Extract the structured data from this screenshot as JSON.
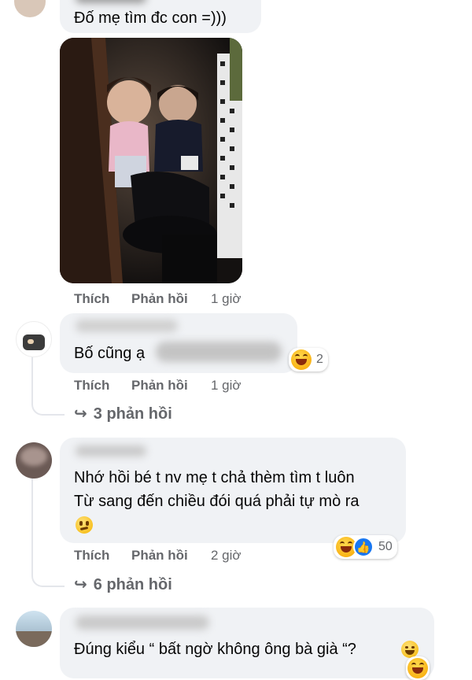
{
  "comment1": {
    "text": "Đố mẹ tìm đc con =)))",
    "actions": {
      "like": "Thích",
      "reply": "Phản hồi",
      "time": "1 giờ"
    }
  },
  "comment2": {
    "text": "Bố cũng ạ",
    "reaction_count": "2",
    "actions": {
      "like": "Thích",
      "reply": "Phản hồi",
      "time": "1 giờ"
    },
    "replies": "3 phản hồi"
  },
  "comment3": {
    "line1": "Nhớ hồi bé t nv mẹ t chả thèm tìm t luôn",
    "line2": "Từ sang đến chiều đói quá phải tự mò ra",
    "reaction_count": "50",
    "actions": {
      "like": "Thích",
      "reply": "Phản hồi",
      "time": "2 giờ"
    },
    "replies": "6 phản hồi"
  },
  "comment4": {
    "text": "Đúng kiểu “ bất ngờ không ông bà già “?"
  },
  "colors": {
    "bubble": "#f0f2f5",
    "meta": "#65676b",
    "like_blue": "#1877f2"
  },
  "icons": [
    "reply-arrow-icon",
    "haha-reaction-icon",
    "like-reaction-icon",
    "smirk-emoji-icon",
    "laugh-emoji-icon"
  ]
}
